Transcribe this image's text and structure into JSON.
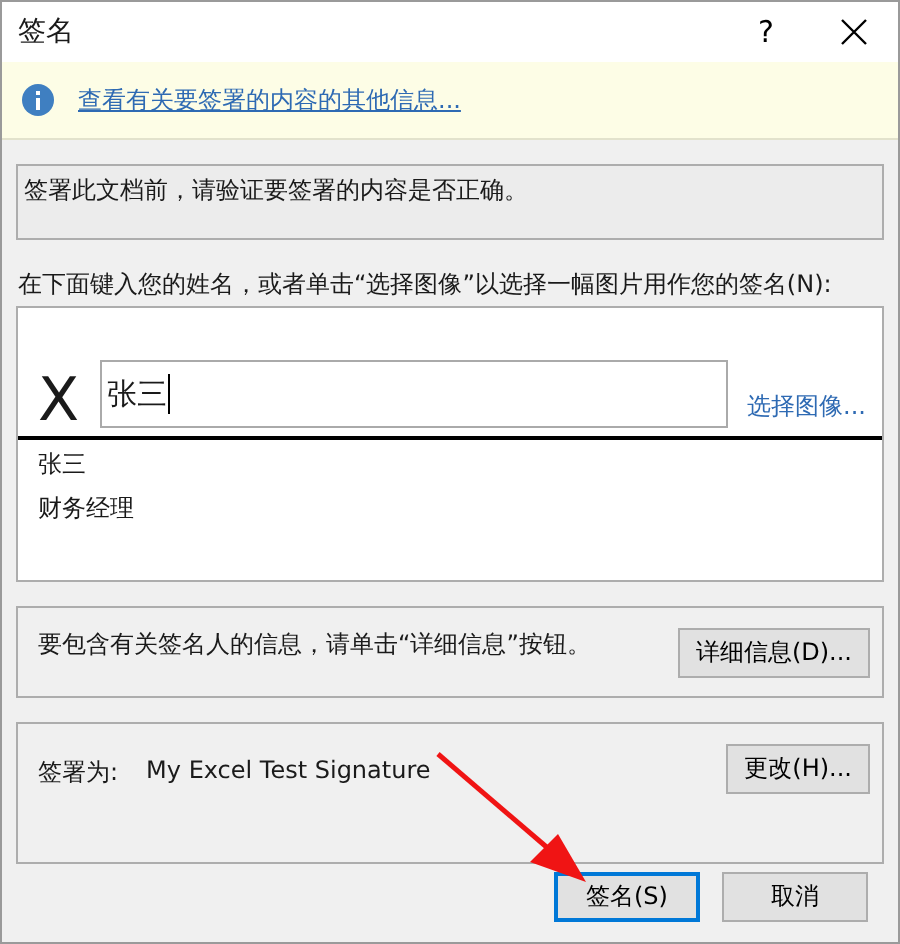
{
  "window": {
    "title": "签名",
    "help": "?"
  },
  "info_bar": {
    "link": "查看有关要签署的内容的其他信息..."
  },
  "verify_note": "签署此文档前，请验证要签署的内容是否正确。",
  "name_prompt": "在下面键入您的姓名，或者单击“选择图像”以选择一幅图片用作您的签名(N):",
  "signature": {
    "mark": "X",
    "value": "张三",
    "select_image": "选择图像...",
    "signer_lines": [
      "张三",
      "财务经理"
    ]
  },
  "details": {
    "text": "要包含有关签名人的信息，请单击“详细信息”按钮。",
    "button": "详细信息(D)..."
  },
  "signing_as": {
    "label": "签署为:",
    "value": "My Excel Test Signature",
    "button": "更改(H)..."
  },
  "buttons": [
    {
      "label": "签名(S)",
      "default": true
    },
    {
      "label": "取消",
      "default": false
    }
  ]
}
